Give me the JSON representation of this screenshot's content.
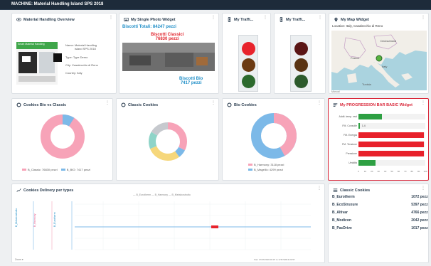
{
  "header": {
    "title": "MACHINE: Material Handling Island SPS 2018"
  },
  "overview": {
    "title": "Material Handling Overview",
    "photo_sign": "Smart Material Handling",
    "name_label": "Name:",
    "name_value": "Material Handling Island SPS 2018",
    "type_label": "Type:",
    "type_value": "Type Demo",
    "city_label": "City:",
    "city_value": "Casalecchio di Reno",
    "country_label": "Country:",
    "country_value": "Italy"
  },
  "photo_widget": {
    "title": "My Single Photo Widget",
    "totals_label": "Biscotti Totali",
    "totals_value": "84247 pezzi",
    "classici_label": "Biscotti Classici",
    "classici_value": "76830 pezzi",
    "bio_label": "Biscotti Bio",
    "bio_value": "7417 pezzi"
  },
  "traffic1": {
    "title": "My Traffi...",
    "active": "red"
  },
  "traffic2": {
    "title": "My Traffi...",
    "active": "none"
  },
  "map": {
    "title": "My Map Widget",
    "location_label": "Location:",
    "location_value": "Italy, Casalecchio di Reno",
    "labels": [
      "France",
      "Italy",
      "Deutschland",
      "Tunisia"
    ],
    "footer": "Manual"
  },
  "cookies_bio_vs_classic": {
    "title": "Cookies Bio vs Classic",
    "legend": [
      "B_Classic: 76830 pezzi",
      "B_BIO: 7417 pezzi"
    ],
    "colors": [
      "#f7a3b8",
      "#7cb9e8"
    ]
  },
  "classic_cookies": {
    "title": "Classic Cookies"
  },
  "bio_cookies": {
    "title": "Bio Cookies",
    "legend": [
      "B_Harmony: 3118 pezzi",
      "B_Magellic: 4299 pezzi"
    ],
    "colors": [
      "#f7a3b8",
      "#7cb9e8"
    ]
  },
  "progress_widget": {
    "title": "My PROGRESSION BAR BASIC Widget",
    "rows": [
      {
        "label": "Addit. temp. real",
        "value": 35,
        "color": "#2ea043"
      },
      {
        "label": "FM. Consolle",
        "value": 2,
        "color": "#2ea043",
        "text": "1.4"
      },
      {
        "label": "FM. Energia",
        "value": 98,
        "color": "#e8202a"
      },
      {
        "label": "FM. Tensione",
        "value": 98,
        "color": "#e8202a"
      },
      {
        "label": "Pressione",
        "value": 98,
        "color": "#e8202a"
      },
      {
        "label": "Umidità",
        "value": 25,
        "color": "#2ea043"
      }
    ],
    "ticks": [
      "0",
      "10",
      "20",
      "30",
      "40",
      "50",
      "60",
      "70",
      "80",
      "90",
      "100"
    ]
  },
  "delivery": {
    "title": "Cookies Delivery per types",
    "legend": [
      "B_Eurotherm",
      "B_Harmony",
      "B_Metalcostrutto"
    ],
    "axis_labels": [
      "B_Metalcostrutto",
      "B_Harmony",
      "B_Eurotherm"
    ],
    "footer_left": "Zoom ▾",
    "footer_right": "from 17/07/2019 00:07 to 17/07/2019 23:57"
  },
  "classic_list": {
    "title": "Classic Cookies",
    "items": [
      {
        "name": "B_Eurotherm",
        "value": "1072 pezzi"
      },
      {
        "name": "B_EcoStruxure",
        "value": "5397 pezzi"
      },
      {
        "name": "B_Altivar",
        "value": "4766 pezzi"
      },
      {
        "name": "B_Modicon",
        "value": "2042 pezzi"
      },
      {
        "name": "B_PacDrive",
        "value": "1017 pezzi"
      }
    ]
  }
}
